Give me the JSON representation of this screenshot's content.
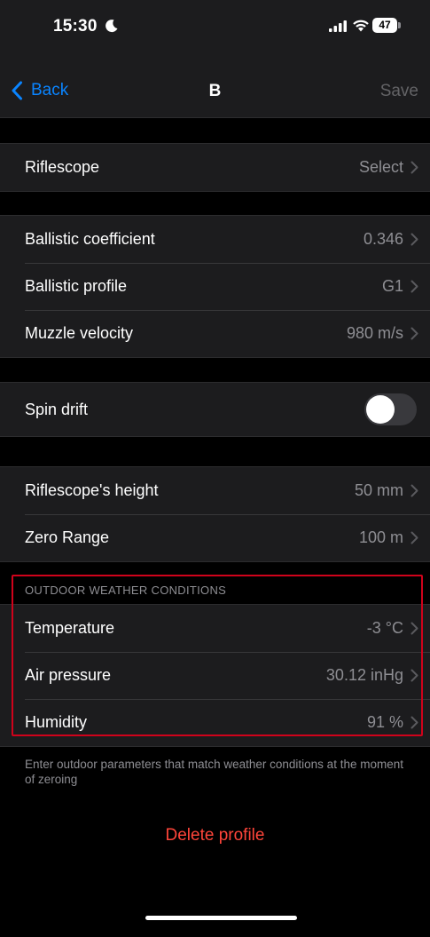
{
  "status": {
    "time": "15:30",
    "battery": "47"
  },
  "nav": {
    "back_label": "Back",
    "title": "B",
    "save_label": "Save"
  },
  "riflescope_group": [
    {
      "label": "Riflescope",
      "value": "Select"
    }
  ],
  "ballistics_group": [
    {
      "label": "Ballistic coefficient",
      "value": "0.346"
    },
    {
      "label": "Ballistic profile",
      "value": "G1"
    },
    {
      "label": "Muzzle velocity",
      "value": "980 m/s"
    }
  ],
  "spin_group": {
    "label": "Spin drift",
    "enabled": false
  },
  "zero_group": [
    {
      "label": "Riflescope's height",
      "value": "50 mm"
    },
    {
      "label": "Zero Range",
      "value": "100 m"
    }
  ],
  "weather": {
    "header": "OUTDOOR WEATHER CONDITIONS",
    "rows": [
      {
        "label": "Temperature",
        "value": "-3 °C"
      },
      {
        "label": "Air pressure",
        "value": "30.12 inHg"
      },
      {
        "label": "Humidity",
        "value": "91 %"
      }
    ],
    "footer": "Enter outdoor parameters that match weather conditions at the moment of zeroing"
  },
  "delete_label": "Delete profile",
  "colors": {
    "accent": "#0a84ff",
    "destructive": "#ff453a",
    "highlight": "#d0021b",
    "secondary_text": "#8e8e93"
  },
  "icons": [
    "moon-icon",
    "signal-icon",
    "wifi-icon",
    "battery-icon",
    "back-chevron-icon",
    "chevron-right-icon"
  ]
}
